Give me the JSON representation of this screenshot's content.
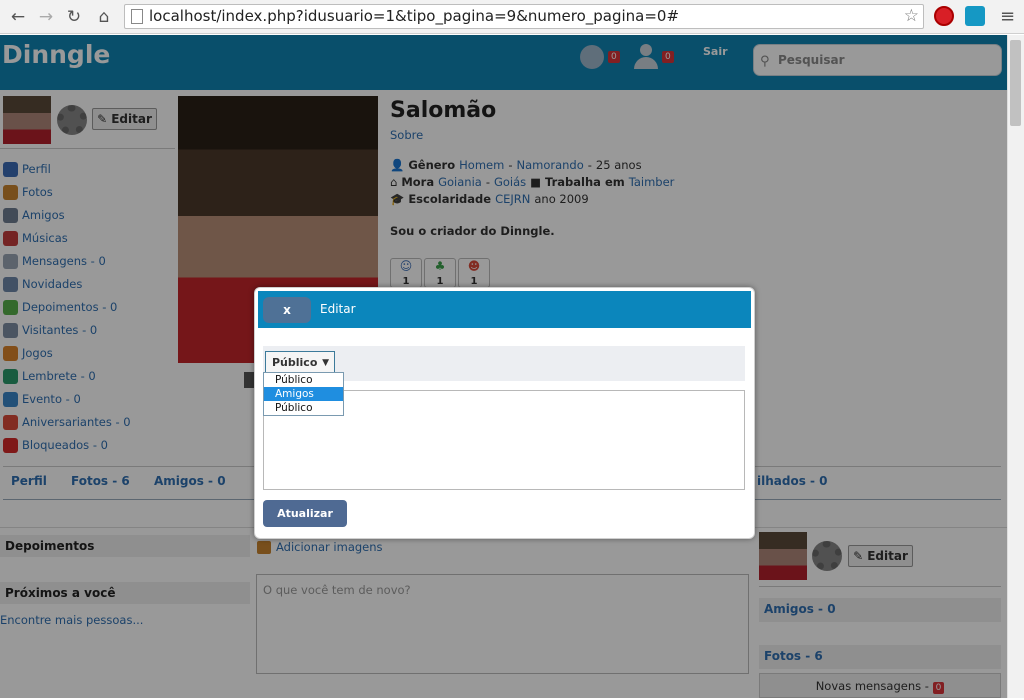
{
  "browser": {
    "url": "localhost/index.php?idusuario=1&tipo_pagina=9&numero_pagina=0#"
  },
  "app": {
    "logo": "Dinngle",
    "sair": "Sair",
    "search_placeholder": "Pesquisar",
    "world_count": "0",
    "friend_count": "0"
  },
  "profile": {
    "edit_label": "Editar",
    "name": "Salomão",
    "about": "Sobre",
    "gender_label": "Gênero",
    "gender": "Homem",
    "status": "Namorando",
    "age": "25 anos",
    "lives_label": "Mora",
    "city": "Goiania",
    "state": "Goiás",
    "works_label": "Trabalha em",
    "employer": "Taimber",
    "school_label": "Escolaridade",
    "school": "CEJRN",
    "school_year": "ano 2009",
    "bio": "Sou o criador do Dinngle.",
    "reactions": [
      "1",
      "1",
      "1"
    ]
  },
  "sidebar": {
    "items": [
      {
        "label": "Perfil",
        "color": "#3b6cb6"
      },
      {
        "label": "Fotos",
        "color": "#c9842f"
      },
      {
        "label": "Amigos",
        "color": "#6f7d92"
      },
      {
        "label": "Músicas",
        "color": "#c23c3c"
      },
      {
        "label": "Mensagens - 0",
        "color": "#9aa5b5"
      },
      {
        "label": "Novidades",
        "color": "#6f87a8"
      },
      {
        "label": "Depoimentos - 0",
        "color": "#58b04a"
      },
      {
        "label": "Visitantes - 0",
        "color": "#7e8ea3"
      },
      {
        "label": "Jogos",
        "color": "#d9822b"
      },
      {
        "label": "Lembrete - 0",
        "color": "#2a9a6c"
      },
      {
        "label": "Evento - 0",
        "color": "#3a86c8"
      },
      {
        "label": "Aniversariantes - 0",
        "color": "#d94a3a"
      },
      {
        "label": "Bloqueados - 0",
        "color": "#d42b2b"
      }
    ]
  },
  "tabs": {
    "perfil": "Perfil",
    "fotos": "Fotos - 6",
    "amigos": "Amigos - 0",
    "compartilhados": "ilhados - 0"
  },
  "panels": {
    "depoimentos": "Depoimentos",
    "proximos": "Próximos a você",
    "encontre": "Encontre mais pessoas...",
    "add_images": "Adicionar imagens",
    "post_placeholder": "O que você tem de novo?",
    "right_edit": "Editar",
    "right_amigos": "Amigos - 0",
    "right_fotos": "Fotos - 6",
    "novas_mensagens": "Novas mensagens -",
    "novas_count": "0"
  },
  "modal": {
    "close": "x",
    "title": "Editar",
    "select_value": "Público",
    "update": "Atualizar",
    "options": [
      "Público",
      "Amigos",
      "Público"
    ],
    "selected_index": 1
  }
}
